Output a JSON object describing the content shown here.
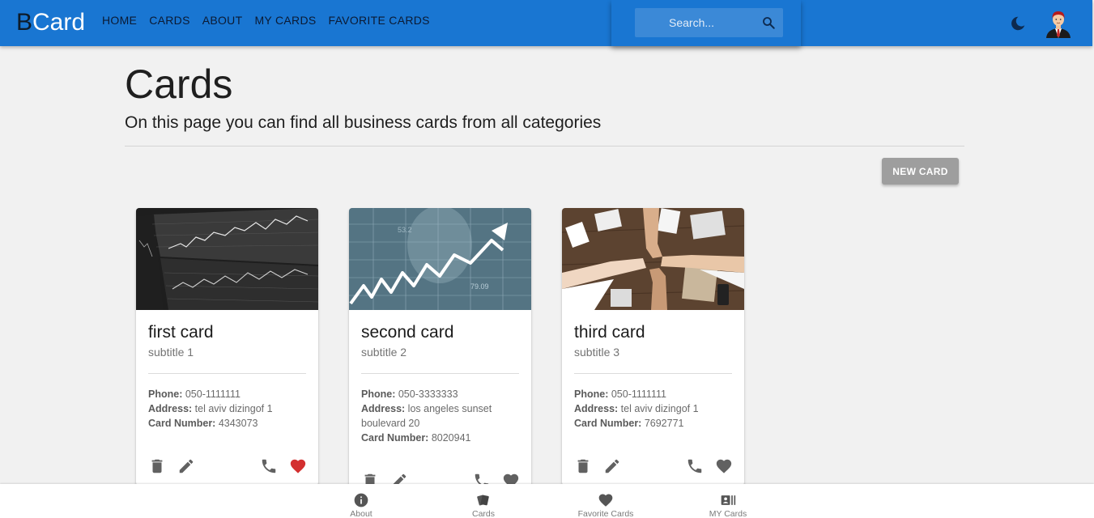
{
  "header": {
    "brand_first": "B",
    "brand_rest": "Card",
    "nav": [
      "HOME",
      "CARDS",
      "ABOUT",
      "MY CARDS",
      "FAVORITE CARDS"
    ],
    "search_placeholder": "Search..."
  },
  "page": {
    "title": "Cards",
    "subtitle": "On this page you can find all business cards from all categories",
    "new_card_label": "NEW CARD"
  },
  "labels": {
    "phone": "Phone:",
    "address": "Address:",
    "card_number": "Card Number:"
  },
  "cards": [
    {
      "title": "first card",
      "subtitle": "subtitle 1",
      "phone": "050-1111111",
      "address": "tel aviv dizingof 1",
      "card_number": "4343073",
      "favorite": true,
      "image": "stock-charts-screens"
    },
    {
      "title": "second card",
      "subtitle": "subtitle 2",
      "phone": "050-3333333",
      "address": "los angeles sunset boulevard 20",
      "card_number": "8020941",
      "favorite": false,
      "image": "rising-arrow-graph"
    },
    {
      "title": "third card",
      "subtitle": "subtitle 3",
      "phone": "050-1111111",
      "address": "tel aviv dizingof 1",
      "card_number": "7692771",
      "favorite": false,
      "image": "team-fist-bump"
    }
  ],
  "bottom_nav": [
    "About",
    "Cards",
    "Favorite Cards",
    "MY Cards"
  ],
  "colors": {
    "primary": "#1976d2",
    "favorite_active": "#d32f2f",
    "icon": "#616161"
  }
}
